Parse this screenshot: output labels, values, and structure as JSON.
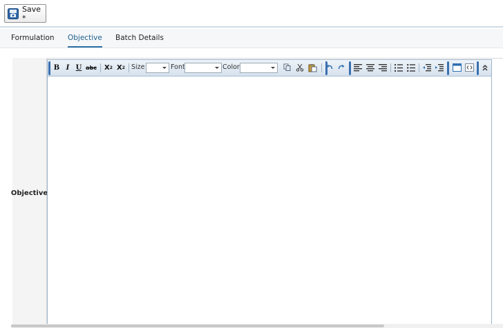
{
  "toolbar": {
    "save_label": "Save *",
    "save_icon": "save-icon"
  },
  "tabs": [
    {
      "label": "Formulation",
      "active": false
    },
    {
      "label": "Objective",
      "active": true
    },
    {
      "label": "Batch Details",
      "active": false
    }
  ],
  "form": {
    "field_label": "Objective"
  },
  "editor": {
    "size_label": "Size",
    "font_label": "Font",
    "color_label": "Color",
    "size_value": "",
    "font_value": "",
    "color_value": "",
    "buttons": {
      "bold": "B",
      "italic": "I",
      "underline": "U",
      "strike": "abc",
      "subscript": "X",
      "superscript": "X"
    },
    "icons": [
      "copy-icon",
      "cut-icon",
      "paste-icon",
      "undo-icon",
      "redo-icon",
      "align-left-icon",
      "align-center-icon",
      "align-right-icon",
      "ordered-list-icon",
      "unordered-list-icon",
      "outdent-icon",
      "indent-icon",
      "window-icon",
      "source-icon",
      "collapse-icon"
    ],
    "accent_color": "#3a6fb0"
  }
}
